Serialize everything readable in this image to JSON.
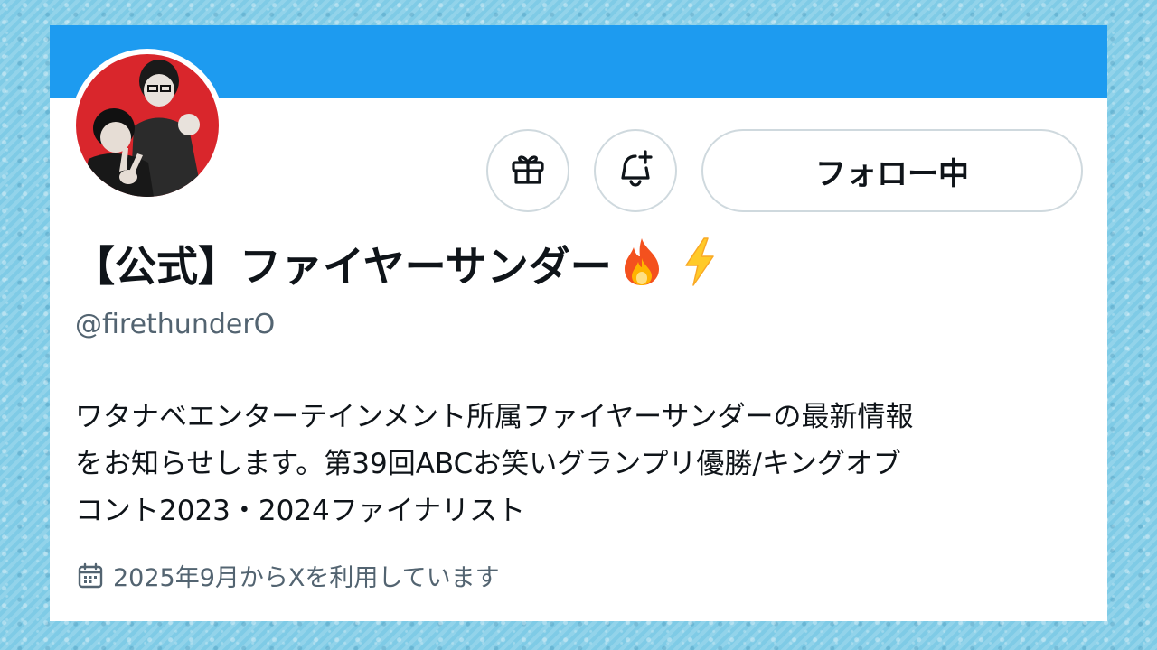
{
  "profile": {
    "display_name": "【公式】ファイヤーサンダー",
    "name_emoji_1": "fire-emoji",
    "name_emoji_2": "lightning-emoji",
    "handle": "@firethunderO",
    "bio_lines": [
      "ワタナベエンターテインメント所属ファイヤーサンダーの最新情報",
      "をお知らせします。第39回ABCお笑いグランプリ優勝/キングオブ",
      "コント2023・2024ファイナリスト"
    ],
    "joined": "2025年9月からXを利用しています"
  },
  "actions": {
    "gift_icon": "gift-icon",
    "notify_icon": "bell-plus-icon",
    "follow_label": "フォロー中"
  },
  "colors": {
    "banner": "#1d9bf0",
    "avatar_bg": "#d9262c",
    "text_primary": "#0f1419",
    "text_secondary": "#536471",
    "border": "#cfd9de",
    "background": "#7fcbe6"
  }
}
